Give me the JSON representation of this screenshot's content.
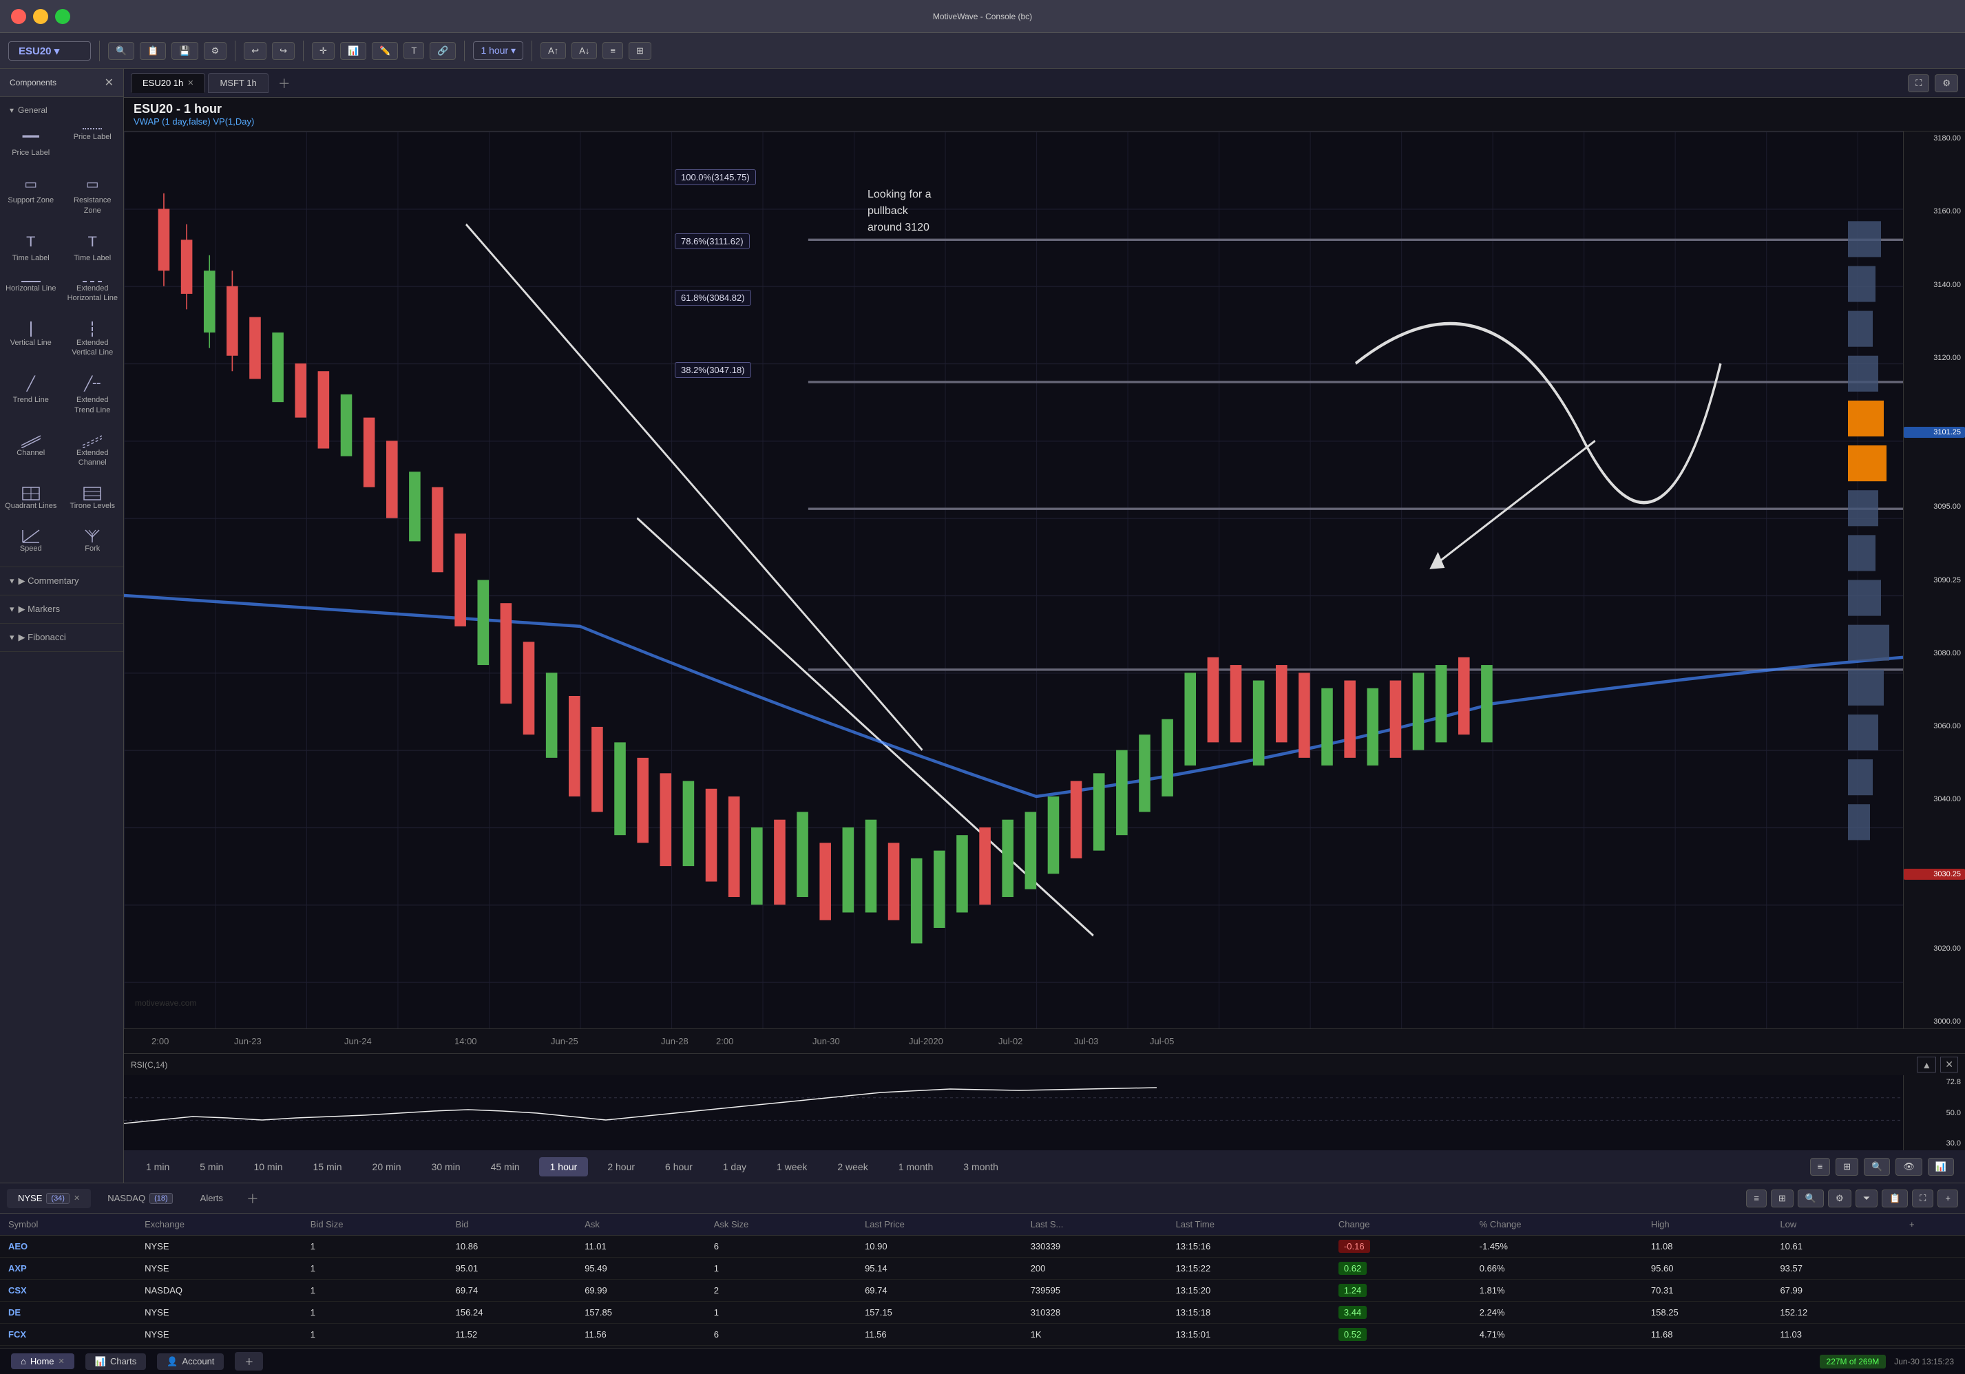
{
  "app": {
    "title": "MotiveWave - Console (bc)",
    "version": "MotiveWave"
  },
  "titlebar": {
    "title": "MotiveWave - Console (bc)"
  },
  "toolbar": {
    "symbol": "ESU20",
    "timeframe": "1 hour",
    "buttons": [
      "ESU20 ▾",
      "🔍",
      "📋",
      "💾",
      "⚡",
      "↩",
      "↪",
      "🎯",
      "📈",
      "➕",
      "✏️",
      "T",
      "🔗",
      "1 hour"
    ]
  },
  "sidebar": {
    "header": "Components",
    "close_label": "✕",
    "sections": [
      {
        "name": "General",
        "items": [
          {
            "id": "price-label-1",
            "icon": "━━",
            "label": "Price Label"
          },
          {
            "id": "price-label-2",
            "icon": "━━",
            "label": "Price Label"
          },
          {
            "id": "support-zone",
            "icon": "▭",
            "label": "Support Zone"
          },
          {
            "id": "resistance-zone",
            "icon": "▭",
            "label": "Resistance Zone"
          },
          {
            "id": "time-label-1",
            "icon": "𝖳",
            "label": "Time Label"
          },
          {
            "id": "time-label-2",
            "icon": "𝖳",
            "label": "Time Label"
          },
          {
            "id": "horizontal-line",
            "icon": "─",
            "label": "Horizontal Line"
          },
          {
            "id": "extended-horizontal-line",
            "icon": "╌╌",
            "label": "Extended Horizontal Line"
          },
          {
            "id": "vertical-line",
            "icon": "│",
            "label": "Vertical Line"
          },
          {
            "id": "extended-vertical-line",
            "icon": "┊",
            "label": "Extended Vertical Line"
          },
          {
            "id": "trend-line",
            "icon": "╱",
            "label": "Trend Line"
          },
          {
            "id": "extended-trend-line",
            "icon": "╱╌",
            "label": "Extended Trend Line"
          },
          {
            "id": "channel",
            "icon": "⫶",
            "label": "Channel"
          },
          {
            "id": "extended-channel",
            "icon": "⫶╌",
            "label": "Extended Channel"
          },
          {
            "id": "quadrant-lines",
            "icon": "⊞",
            "label": "Quadrant Lines"
          },
          {
            "id": "tirone-levels",
            "icon": "⊟",
            "label": "Tirone Levels"
          },
          {
            "id": "speed",
            "icon": "◫",
            "label": "Speed"
          },
          {
            "id": "fork",
            "icon": "⑂",
            "label": "Fork"
          }
        ]
      },
      {
        "name": "Commentary",
        "items": []
      },
      {
        "name": "Markers",
        "items": []
      },
      {
        "name": "Fibonacci",
        "items": []
      }
    ]
  },
  "tabs": [
    {
      "id": "esu20-1h",
      "label": "ESU20 1h",
      "closable": true,
      "active": true
    },
    {
      "id": "msft-1h",
      "label": "MSFT 1h",
      "closable": false,
      "active": false
    }
  ],
  "chart": {
    "symbol": "ESU20",
    "timeframe": "1 hour",
    "title": "ESU20 - 1 hour",
    "vwap_label": "VWAP (1 day,false)  VP(1,Day)",
    "watermark": "motivewave.com",
    "annotation": "Looking for a\npullback\naround 3120",
    "fib_levels": [
      {
        "pct": "100.0%",
        "price": "3145.75",
        "y_pct": 12
      },
      {
        "pct": "78.6%",
        "price": "3111.62",
        "y_pct": 28
      },
      {
        "pct": "61.8%",
        "price": "3084.82",
        "y_pct": 42
      },
      {
        "pct": "38.2%",
        "price": "3047.18",
        "y_pct": 60
      }
    ],
    "price_scale": {
      "labels": [
        {
          "value": "3180.00",
          "y_pct": 2,
          "highlight": false
        },
        {
          "value": "3160.00",
          "y_pct": 10,
          "highlight": false
        },
        {
          "value": "3140.00",
          "y_pct": 18,
          "highlight": false
        },
        {
          "value": "3120.00",
          "y_pct": 26,
          "highlight": false
        },
        {
          "value": "3101.25",
          "y_pct": 34,
          "highlight": true,
          "type": "blue"
        },
        {
          "value": "3095.00",
          "y_pct": 37,
          "highlight": false
        },
        {
          "value": "3090.25",
          "y_pct": 39,
          "highlight": false
        },
        {
          "value": "3080.00",
          "y_pct": 44,
          "highlight": false
        },
        {
          "value": "3060.00",
          "y_pct": 54,
          "highlight": false
        },
        {
          "value": "3040.00",
          "y_pct": 64,
          "highlight": false
        },
        {
          "value": "3030.25",
          "y_pct": 69,
          "highlight": true,
          "type": "red"
        },
        {
          "value": "3020.00",
          "y_pct": 74,
          "highlight": false
        },
        {
          "value": "3000.00",
          "y_pct": 84,
          "highlight": false
        }
      ]
    },
    "time_labels": [
      "2:00",
      "Jun-23",
      "Jun-24",
      "14:00",
      "Jun-25",
      "Jun-28",
      "2:00",
      "Jun-30",
      "Jul-2020",
      "Jul-02",
      "Jul-03",
      "Jul-05"
    ]
  },
  "rsi": {
    "label": "RSI(C,14)",
    "values": {
      "current": "72.8",
      "upper": "72.8",
      "middle": "50.0",
      "lower": "30.0"
    }
  },
  "timeframes": [
    {
      "label": "1 min",
      "active": false
    },
    {
      "label": "5 min",
      "active": false
    },
    {
      "label": "10 min",
      "active": false
    },
    {
      "label": "15 min",
      "active": false
    },
    {
      "label": "20 min",
      "active": false
    },
    {
      "label": "30 min",
      "active": false
    },
    {
      "label": "45 min",
      "active": false
    },
    {
      "label": "1 hour",
      "active": true
    },
    {
      "label": "2 hour",
      "active": false
    },
    {
      "label": "6 hour",
      "active": false
    },
    {
      "label": "1 day",
      "active": false
    },
    {
      "label": "1 week",
      "active": false
    },
    {
      "label": "2 week",
      "active": false
    },
    {
      "label": "1 month",
      "active": false
    },
    {
      "label": "3 month",
      "active": false
    }
  ],
  "watchlist_tabs": [
    {
      "id": "nyse",
      "label": "NYSE",
      "badge": "34",
      "active": true
    },
    {
      "id": "nasdaq",
      "label": "NASDAQ",
      "badge": "18",
      "active": false
    },
    {
      "id": "alerts",
      "label": "Alerts",
      "active": false
    }
  ],
  "watchlist": {
    "columns": [
      "Symbol",
      "Exchange",
      "Bid Size",
      "Bid",
      "Ask",
      "Ask Size",
      "Last Price",
      "Last S...",
      "Last Time",
      "Change",
      "% Change",
      "High",
      "Low"
    ],
    "rows": [
      {
        "symbol": "AEO",
        "exchange": "NYSE",
        "bid_size": "1",
        "bid": "10.86",
        "ask": "11.01",
        "ask_size": "6",
        "last_price": "10.90",
        "last_s": "330339",
        "last_time": "13:15:16",
        "change": "-0.16",
        "change_pct": "-1.45%",
        "high": "11.08",
        "low": "10.61",
        "change_type": "neg"
      },
      {
        "symbol": "AXP",
        "exchange": "NYSE",
        "bid_size": "1",
        "bid": "95.01",
        "ask": "95.49",
        "ask_size": "1",
        "last_price": "95.14",
        "last_s": "200",
        "last_time": "13:15:22",
        "change": "0.62",
        "change_pct": "0.66%",
        "high": "95.60",
        "low": "93.57",
        "change_type": "pos"
      },
      {
        "symbol": "CSX",
        "exchange": "NASDAQ",
        "bid_size": "1",
        "bid": "69.74",
        "ask": "69.99",
        "ask_size": "2",
        "last_price": "69.74",
        "last_s": "739595",
        "last_time": "13:15:20",
        "change": "1.24",
        "change_pct": "1.81%",
        "high": "70.31",
        "low": "67.99",
        "change_type": "pos"
      },
      {
        "symbol": "DE",
        "exchange": "NYSE",
        "bid_size": "1",
        "bid": "156.24",
        "ask": "157.85",
        "ask_size": "1",
        "last_price": "157.15",
        "last_s": "310328",
        "last_time": "13:15:18",
        "change": "3.44",
        "change_pct": "2.24%",
        "high": "158.25",
        "low": "152.12",
        "change_type": "pos"
      },
      {
        "symbol": "FCX",
        "exchange": "NYSE",
        "bid_size": "1",
        "bid": "11.52",
        "ask": "11.56",
        "ask_size": "6",
        "last_price": "11.56",
        "last_s": "1K",
        "last_time": "13:15:01",
        "change": "0.52",
        "change_pct": "4.71%",
        "high": "11.68",
        "low": "11.03",
        "change_type": "pos"
      }
    ]
  },
  "bottom_bar": {
    "tabs": [
      {
        "id": "home",
        "label": "Home",
        "icon": "⌂",
        "active": true,
        "closable": true
      },
      {
        "id": "charts",
        "label": "Charts",
        "icon": "📊",
        "active": false
      },
      {
        "id": "account",
        "label": "Account",
        "icon": "👤",
        "active": false
      }
    ],
    "memory": "227M of 269M",
    "datetime": "Jun-30  13:15:23"
  }
}
